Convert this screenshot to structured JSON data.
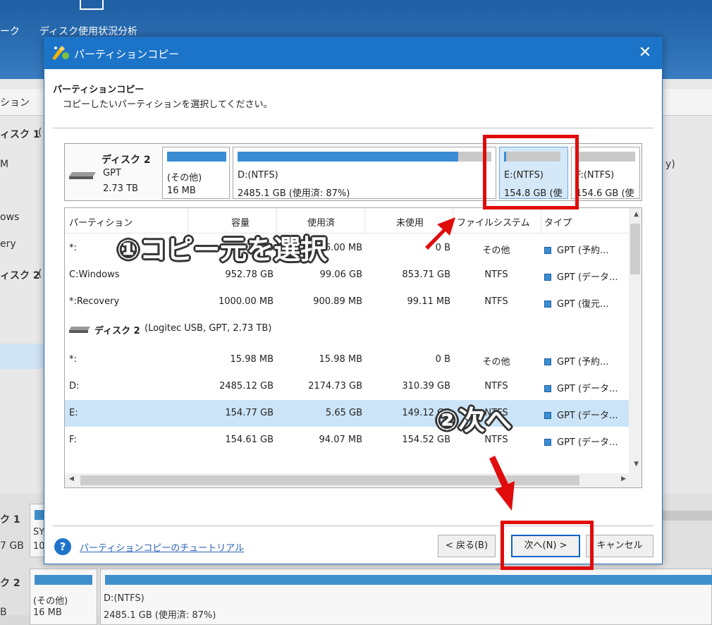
{
  "background": {
    "toolbar_item_partial": "ーク",
    "toolbar_item": "ディスク使用状況分析",
    "col_header_partial": "ション",
    "left_rows": [
      "ィスク 1",
      "M",
      "ows",
      "ery",
      "ィスク 2"
    ],
    "left_row_1_suffix": "(",
    "left_row_5_suffix": "(",
    "right_partial": "y)",
    "bottom": {
      "disk1_label": "ク 1",
      "disk1_sys": "SY",
      "disk1_size": "7 GB",
      "disk1_num": "10",
      "disk2_label": "ク 2",
      "disk2_size": "B",
      "p1_line1": "(その他)",
      "p1_line2": "16 MB",
      "p2_line1": "D:(NTFS)",
      "p2_line2": "2485.1 GB (使用済: 87%)"
    }
  },
  "dialog": {
    "title": "パーティションコピー",
    "close_icon": "close-icon",
    "heading": "パーティションコピー",
    "subtitle": "コピーしたいパーティションを選択してください。",
    "disk_map": {
      "name": "ディスク 2",
      "type": "GPT",
      "size": "2.73 TB",
      "partitions": [
        {
          "line1": "(その他)",
          "line2": "16 MB",
          "used_fraction": 1.0
        },
        {
          "line1": "D:(NTFS)",
          "line2": "2485.1 GB (使用済: 87%)",
          "used_fraction": 0.87
        },
        {
          "line1": "E:(NTFS)",
          "line2": "154.8 GB (使",
          "used_fraction": 0.04
        },
        {
          "line1": "F:(NTFS)",
          "line2": "154.6 GB (使",
          "used_fraction": 0.0
        }
      ]
    },
    "table": {
      "headers": [
        "パーティション",
        "容量",
        "使用済",
        "未使用",
        "ファイルシステム",
        "タイプ"
      ],
      "rows_disk1": [
        {
          "partition": "*:",
          "capacity": "16.00 MB",
          "used": "16.00 MB",
          "unused": "0 B",
          "fs": "その他",
          "type": "GPT (予約..."
        },
        {
          "partition": "C:Windows",
          "capacity": "952.78 GB",
          "used": "99.06 GB",
          "unused": "853.71 GB",
          "fs": "NTFS",
          "type": "GPT (データ..."
        },
        {
          "partition": "*:Recovery",
          "capacity": "1000.00 MB",
          "used": "900.89 MB",
          "unused": "99.11 MB",
          "fs": "NTFS",
          "type": "GPT (復元..."
        }
      ],
      "disk2_header": "ディスク 2",
      "disk2_detail": "(Logitec USB, GPT, 2.73 TB)",
      "rows_disk2": [
        {
          "partition": "*:",
          "capacity": "15.98 MB",
          "used": "15.98 MB",
          "unused": "0 B",
          "fs": "その他",
          "type": "GPT (予約..."
        },
        {
          "partition": "D:",
          "capacity": "2485.12 GB",
          "used": "2174.73 GB",
          "unused": "310.39 GB",
          "fs": "NTFS",
          "type": "GPT (データ..."
        },
        {
          "partition": "E:",
          "capacity": "154.77 GB",
          "used": "5.65 GB",
          "unused": "149.12 GB",
          "fs": "NTFS",
          "type": "GPT (データ..."
        },
        {
          "partition": "F:",
          "capacity": "154.61 GB",
          "used": "94.07 MB",
          "unused": "154.52 GB",
          "fs": "NTFS",
          "type": "GPT (データ..."
        }
      ]
    },
    "help_icon": "?",
    "help_link": "パーティションコピーのチュートリアル",
    "buttons": {
      "back": "< 戻る(B)",
      "next": "次へ(N) >",
      "cancel": "キャンセル"
    }
  },
  "annotations": {
    "step1": "①コピー元を選択",
    "step2": "②次へ",
    "color": "#e00c0c"
  }
}
